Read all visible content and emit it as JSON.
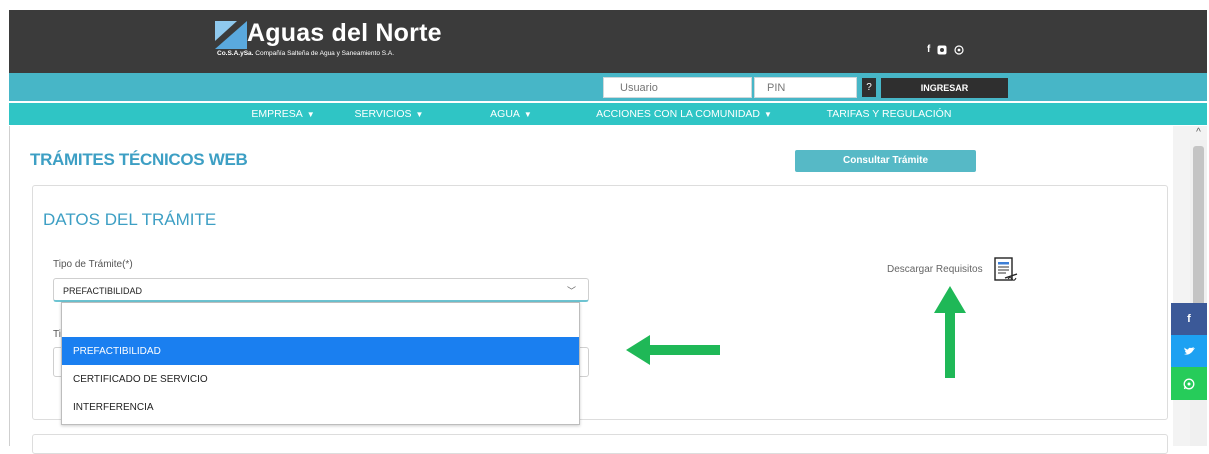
{
  "header": {
    "logo_title": "Aguas del Norte",
    "logo_sub_bold": "Co.S.A.ySa.",
    "logo_sub_rest": " Compañía Salteña de Agua y Saneamiento S.A.",
    "social_icons": [
      "facebook-icon",
      "instagram-icon",
      "whatsapp-icon"
    ]
  },
  "login": {
    "user_placeholder": "Usuario",
    "pin_placeholder": "PIN",
    "help_label": "?",
    "submit_label": "INGRESAR"
  },
  "nav": {
    "items": [
      {
        "label": "EMPRESA",
        "has_dropdown": true
      },
      {
        "label": "SERVICIOS",
        "has_dropdown": true
      },
      {
        "label": "AGUA",
        "has_dropdown": true
      },
      {
        "label": "ACCIONES CON LA COMUNIDAD",
        "has_dropdown": true
      },
      {
        "label": "TARIFAS Y REGULACIÓN",
        "has_dropdown": false
      }
    ],
    "chevron": "❯"
  },
  "page": {
    "title": "TRÁMITES TÉCNICOS WEB",
    "consult_button": "Consultar Trámite"
  },
  "form": {
    "section_title": "DATOS DEL TRÁMITE",
    "tipo_label": "Tipo de Trámite(*)",
    "tipo_value": "PREFACTIBILIDAD",
    "behind_label_partial": "Ti",
    "download_label": "Descargar Requisitos",
    "dropdown_options": [
      "PREFACTIBILIDAD",
      "CERTIFICADO DE SERVICIO",
      "INTERFERENCIA"
    ],
    "selected_option": "PREFACTIBILIDAD"
  },
  "share": {
    "facebook": "f",
    "twitter": "🐦",
    "whatsapp": "✆"
  },
  "colors": {
    "header_bg": "#3b3b3b",
    "login_bar": "#47b6c7",
    "nav_bar": "#2fc5c5",
    "accent_blue": "#3d9fc4",
    "selected_option": "#1a7ff0",
    "arrow_green": "#1fb857"
  }
}
